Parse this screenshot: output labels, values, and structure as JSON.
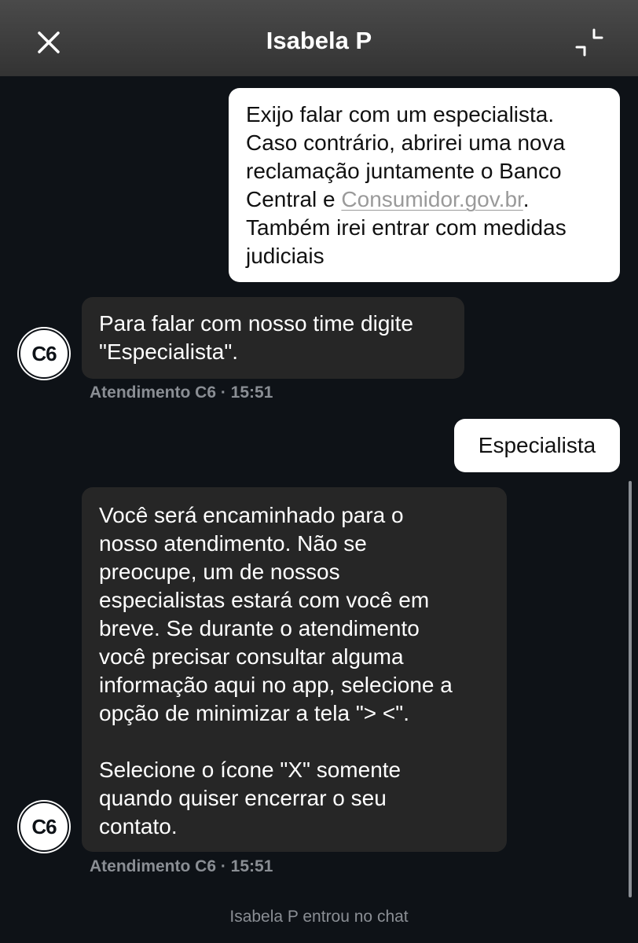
{
  "header": {
    "title": "Isabela P",
    "close_icon": "close-icon",
    "minimize_icon": "minimize-icon"
  },
  "messages": [
    {
      "lines": [
        "Exijo falar com um especialista.",
        "Caso contrário, abrirei uma nova",
        "reclamação juntamente o Banco"
      ],
      "line4_prefix": "Central e ",
      "link": "Consumidor.gov.br",
      "line4_suffix": ".",
      "lines_after": [
        "Também irei entrar com medidas",
        "judiciais"
      ]
    },
    {
      "lines": [
        "Para falar com nosso time digite",
        "\"Especialista\"."
      ],
      "avatar": "C6",
      "meta": "Atendimento C6 · 15:51"
    },
    {
      "text": "Especialista"
    },
    {
      "lines": [
        "Você será encaminhado para o",
        "nosso atendimento. Não se",
        "preocupe, um de nossos",
        "especialistas estará com você em",
        "breve. Se durante o atendimento",
        "você precisar consultar alguma",
        "informação aqui no app, selecione a",
        "opção de minimizar a tela \"> <\"."
      ],
      "lines_after": [
        "Selecione o ícone \"X\" somente",
        "quando quiser encerrar o seu",
        "contato."
      ],
      "avatar": "C6",
      "meta": "Atendimento C6 · 15:51"
    }
  ],
  "system_message": "Isabela P entrou no chat"
}
